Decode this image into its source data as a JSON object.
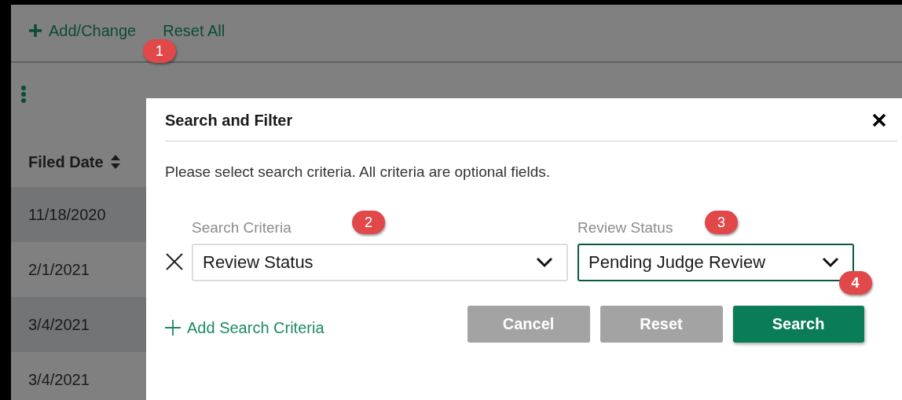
{
  "toolbar": {
    "add_change": {
      "label": "Add/Change",
      "callout": "1"
    },
    "reset_all": "Reset All"
  },
  "table": {
    "columns": [
      {
        "label": "Filed Date"
      }
    ],
    "rows": [
      {
        "filed_date": "11/18/2020"
      },
      {
        "filed_date": "2/1/2021"
      },
      {
        "filed_date": "3/4/2021"
      },
      {
        "filed_date": "3/4/2021"
      }
    ]
  },
  "dialog": {
    "title": "Search and Filter",
    "description": "Please select search criteria. All criteria are optional fields.",
    "criteria": [
      {
        "label": "Search Criteria",
        "value": "Review Status",
        "callout": "2",
        "focused": false
      },
      {
        "label": "Review Status",
        "value": "Pending Judge Review",
        "callout": "3",
        "focused": true
      }
    ],
    "add_criteria": "Add Search Criteria",
    "buttons": [
      {
        "label": "Cancel",
        "kind": "secondary"
      },
      {
        "label": "Reset",
        "kind": "secondary"
      },
      {
        "label": "Search",
        "kind": "primary",
        "callout": "4"
      }
    ]
  }
}
